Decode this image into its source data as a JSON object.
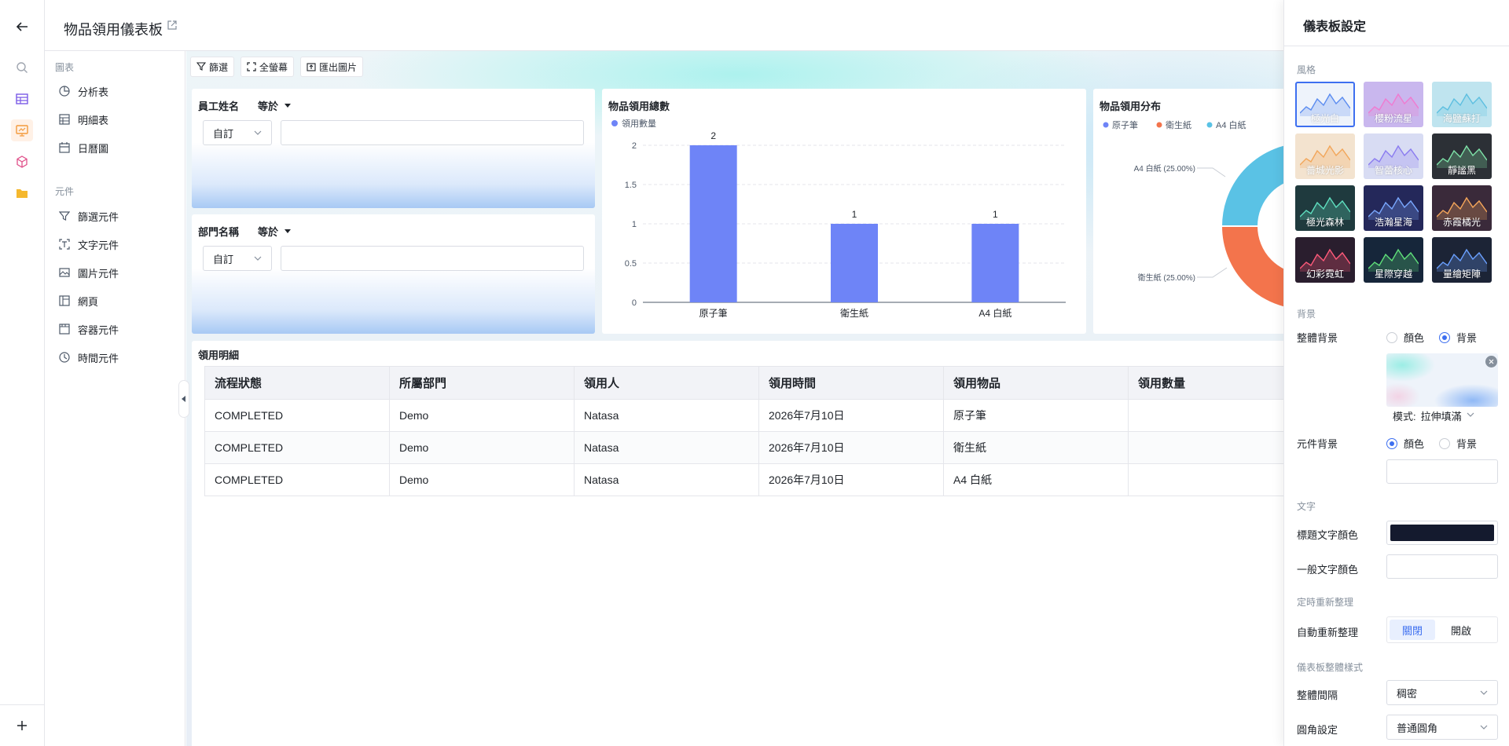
{
  "page": {
    "title": "物品領用儀表板"
  },
  "library": {
    "charts_heading": "圖表",
    "charts": [
      {
        "label": "分析表"
      },
      {
        "label": "明細表"
      },
      {
        "label": "日曆圖"
      }
    ],
    "elements_heading": "元件",
    "elements": [
      {
        "label": "篩選元件"
      },
      {
        "label": "文字元件"
      },
      {
        "label": "圖片元件"
      },
      {
        "label": "網頁"
      },
      {
        "label": "容器元件"
      },
      {
        "label": "時間元件"
      }
    ]
  },
  "toolbar": {
    "filter": "篩選",
    "fullscreen": "全螢幕",
    "export": "匯出圖片"
  },
  "filters": [
    {
      "field": "員工姓名",
      "operator": "等於",
      "mode": "自訂",
      "value": ""
    },
    {
      "field": "部門名稱",
      "operator": "等於",
      "mode": "自訂",
      "value": ""
    }
  ],
  "bar_card": {
    "title": "物品領用總數"
  },
  "pie_card": {
    "title": "物品領用分布"
  },
  "chart_data": [
    {
      "type": "bar",
      "title": "物品領用總數",
      "categories": [
        "原子筆",
        "衛生紙",
        "A4 白紙"
      ],
      "series": [
        {
          "name": "領用數量",
          "values": [
            2,
            1,
            1
          ]
        }
      ],
      "data_labels": [
        "2",
        "1",
        "1"
      ],
      "yticks": [
        "0",
        "0.5",
        "1",
        "1.5",
        "2"
      ],
      "ylim": [
        0,
        2
      ],
      "grid": true,
      "legend": "top-left",
      "color": "#6e84f7"
    },
    {
      "type": "pie",
      "title": "物品領用分布",
      "legend": "top",
      "categories": [
        "原子筆",
        "衛生紙",
        "A4 白紙"
      ],
      "values": [
        2,
        1,
        1
      ],
      "colors": [
        "#6e84f7",
        "#f3744c",
        "#5ac2e5"
      ],
      "visible_labels": [
        "A4 白紙 (25.00%)",
        "衛生紙 (25.00%)"
      ]
    }
  ],
  "table": {
    "title": "領用明細",
    "columns": [
      "流程狀態",
      "所屬部門",
      "領用人",
      "領用時間",
      "領用物品",
      "領用數量"
    ],
    "rows": [
      [
        "COMPLETED",
        "Demo",
        "Natasa",
        "2026年7月10日",
        "原子筆",
        ""
      ],
      [
        "COMPLETED",
        "Demo",
        "Natasa",
        "2026年7月10日",
        "衛生紙",
        ""
      ],
      [
        "COMPLETED",
        "Demo",
        "Natasa",
        "2026年7月10日",
        "A4 白紙",
        ""
      ]
    ]
  },
  "settings": {
    "title": "儀表板設定",
    "style_heading": "風格",
    "themes": [
      {
        "name": "極光白",
        "bg": "#eef3fb",
        "line": "#5b8cf0",
        "selected": true
      },
      {
        "name": "櫻粉流星",
        "bg": "#c9b7ee",
        "line": "#f07ad0"
      },
      {
        "name": "海鹽蘇打",
        "bg": "#bfe4ef",
        "line": "#5dbfe0"
      },
      {
        "name": "薔城光影",
        "bg": "#f3e3cf",
        "line": "#f2a65a"
      },
      {
        "name": "智蕾核心",
        "bg": "#d8dcf3",
        "line": "#8a7bf0"
      },
      {
        "name": "靜謐黑",
        "bg": "#2c3036",
        "line": "#7ee2a8"
      },
      {
        "name": "極光森林",
        "bg": "#1f3a3e",
        "line": "#5fe0c0"
      },
      {
        "name": "浩瀚星海",
        "bg": "#24285a",
        "line": "#7aa8ff"
      },
      {
        "name": "赤霞橘光",
        "bg": "#3a2a3a",
        "line": "#f5a65a"
      },
      {
        "name": "幻彩霓虹",
        "bg": "#2a1e2e",
        "line": "#ff5a7a"
      },
      {
        "name": "星際穿越",
        "bg": "#16263a",
        "line": "#5fe07a"
      },
      {
        "name": "量繪矩陣",
        "bg": "#1c2436",
        "line": "#6aa0ff"
      }
    ],
    "background_heading": "背景",
    "overall_bg_label": "整體背景",
    "overall_bg_options": [
      "顏色",
      "背景"
    ],
    "overall_bg_selected": "背景",
    "mode_label": "模式:",
    "mode_value": "拉伸填滿",
    "element_bg_label": "元件背景",
    "element_bg_options": [
      "顏色",
      "背景"
    ],
    "element_bg_selected": "顏色",
    "text_heading": "文字",
    "title_color_label": "標題文字顏色",
    "title_color": "#141a2e",
    "normal_color_label": "一般文字顏色",
    "normal_color": "#ffffff",
    "refresh_heading": "定時重新整理",
    "auto_refresh_label": "自動重新整理",
    "auto_refresh_options": [
      "關閉",
      "開啟"
    ],
    "auto_refresh_selected": "關閉",
    "layout_heading": "儀表板整體樣式",
    "spacing_label": "整體間隔",
    "spacing_value": "稠密",
    "corner_label": "圓角設定",
    "corner_value": "普通圓角"
  },
  "colors": {
    "accent": "#3d6ff0",
    "bar": "#6e84f7"
  }
}
